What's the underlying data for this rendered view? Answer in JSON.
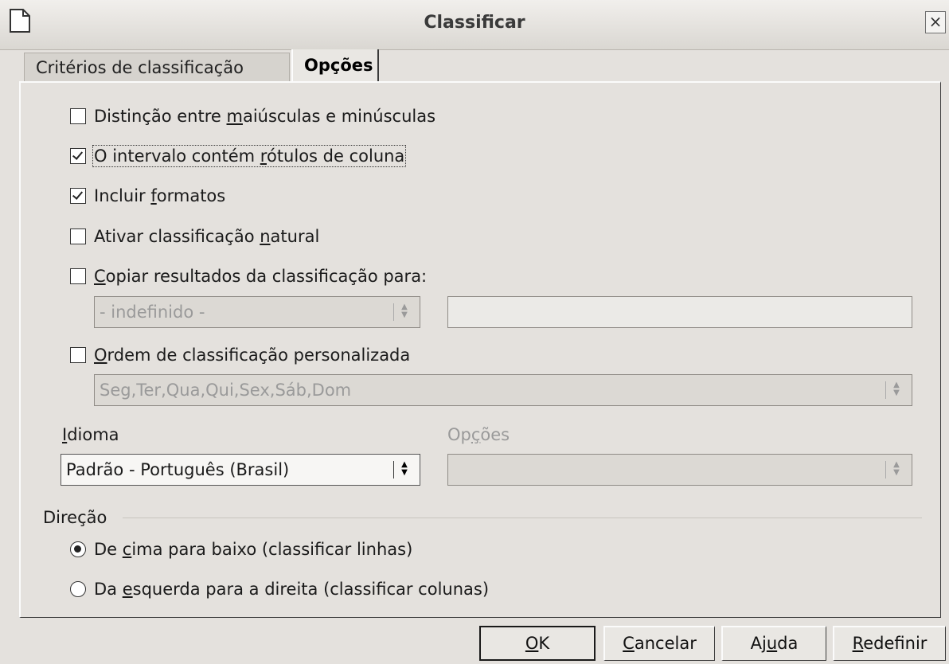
{
  "window": {
    "title": "Classificar"
  },
  "tabs": [
    {
      "label": "Critérios de classificação",
      "active": false
    },
    {
      "label": "Opções",
      "active": true
    }
  ],
  "options": {
    "case_sensitive": {
      "pre": "Distinção entre ",
      "ul": "m",
      "post": "aiúsculas e minúsculas",
      "checked": false
    },
    "has_headers": {
      "pre": "O intervalo contém ",
      "ul": "r",
      "post": "ótulos de coluna",
      "checked": true
    },
    "include_formats": {
      "pre": "Incluir ",
      "ul": "f",
      "post": "ormatos",
      "checked": true
    },
    "natural_sort": {
      "pre": "Ativar classificação ",
      "ul": "n",
      "post": "atural",
      "checked": false
    },
    "copy_results": {
      "pre": "",
      "ul": "C",
      "post": "opiar resultados da classificação para:",
      "checked": false
    },
    "copy_target_select": "- indefinido -",
    "copy_target_input": "",
    "custom_order": {
      "pre": "",
      "ul": "O",
      "post": "rdem de classificação personalizada",
      "checked": false
    },
    "custom_order_select": "Seg,Ter,Qua,Qui,Sex,Sáb,Dom"
  },
  "language": {
    "label_ul": "I",
    "label_post": "dioma",
    "value": "Padrão - Português (Brasil)",
    "options_label_pre": "Op",
    "options_label_ul": "ç",
    "options_label_post": "ões",
    "options_value": ""
  },
  "direction": {
    "title": "Direção",
    "top_bottom": {
      "pre": "De ",
      "ul": "c",
      "post": "ima para baixo (classificar linhas)",
      "selected": true
    },
    "left_right": {
      "pre": "Da ",
      "ul": "e",
      "post": "squerda para a direita (classificar colunas)",
      "selected": false
    }
  },
  "buttons": {
    "ok": {
      "pre": "",
      "ul": "O",
      "post": "K"
    },
    "cancel": {
      "pre": "",
      "ul": "C",
      "post": "ancelar"
    },
    "help": {
      "pre": "Aj",
      "ul": "u",
      "post": "da"
    },
    "reset": {
      "pre": "",
      "ul": "R",
      "post": "edefinir"
    }
  }
}
